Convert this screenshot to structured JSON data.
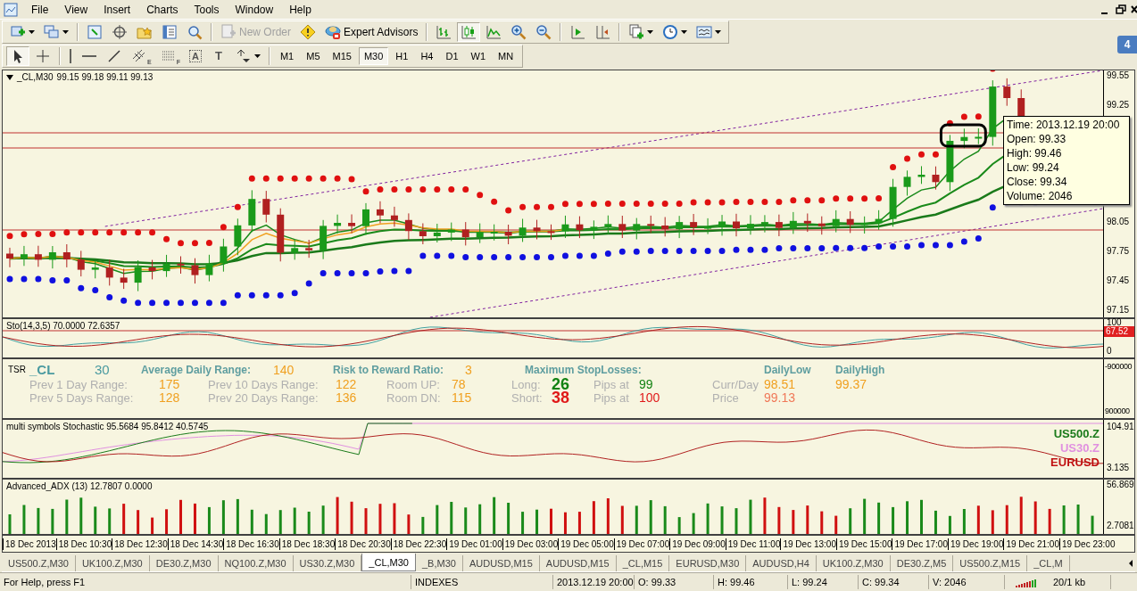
{
  "menu": [
    "File",
    "View",
    "Insert",
    "Charts",
    "Tools",
    "Window",
    "Help"
  ],
  "notification_count": "4",
  "toolbar_main": [
    {
      "kind": "menu-icon",
      "pressed": false
    },
    {
      "kind": "menu-icon",
      "pressed": false
    },
    {
      "kind": "separator"
    },
    {
      "kind": "icon",
      "pressed": false
    },
    {
      "kind": "icon",
      "pressed": false
    },
    {
      "kind": "icon",
      "pressed": false
    },
    {
      "kind": "icon",
      "pressed": false
    },
    {
      "kind": "icon",
      "pressed": false
    },
    {
      "kind": "separator"
    },
    {
      "kind": "labeled",
      "label": "New Order",
      "disabled": true
    },
    {
      "kind": "icon",
      "pressed": false
    },
    {
      "kind": "labeled",
      "label": "Expert Advisors",
      "disabled": false
    },
    {
      "kind": "separator"
    },
    {
      "kind": "icon",
      "pressed": false
    },
    {
      "kind": "icon",
      "pressed": true
    },
    {
      "kind": "icon",
      "pressed": false
    },
    {
      "kind": "icon",
      "pressed": false
    },
    {
      "kind": "icon",
      "pressed": false
    },
    {
      "kind": "separator"
    },
    {
      "kind": "icon",
      "pressed": false
    },
    {
      "kind": "icon",
      "pressed": false
    },
    {
      "kind": "separator"
    },
    {
      "kind": "menu-icon",
      "pressed": false
    },
    {
      "kind": "menu-icon",
      "pressed": false
    },
    {
      "kind": "menu-icon",
      "pressed": false
    }
  ],
  "toolbar_draw": [
    {
      "kind": "icon",
      "pressed": true
    },
    {
      "kind": "icon",
      "pressed": false
    },
    {
      "kind": "separator"
    },
    {
      "kind": "icon",
      "pressed": false
    },
    {
      "kind": "icon",
      "pressed": false
    },
    {
      "kind": "icon",
      "pressed": false
    },
    {
      "kind": "icon",
      "pressed": false,
      "label": "E"
    },
    {
      "kind": "icon",
      "pressed": false,
      "label": "F"
    },
    {
      "kind": "text-icon",
      "pressed": false,
      "label": "A"
    },
    {
      "kind": "text-icon",
      "pressed": false,
      "label": "T"
    },
    {
      "kind": "menu-icon",
      "pressed": false
    },
    {
      "kind": "separator"
    }
  ],
  "timeframes": [
    {
      "label": "M1",
      "selected": false
    },
    {
      "label": "M5",
      "selected": false
    },
    {
      "label": "M15",
      "selected": false
    },
    {
      "label": "M30",
      "selected": true
    },
    {
      "label": "H1",
      "selected": false
    },
    {
      "label": "H4",
      "selected": false
    },
    {
      "label": "D1",
      "selected": false
    },
    {
      "label": "W1",
      "selected": false
    },
    {
      "label": "MN",
      "selected": false
    }
  ],
  "main_chart": {
    "symbol": "_CL,M30",
    "ohlc": "99.15 99.18 99.11 99.13",
    "price_axis": [
      "99.55",
      "99.25",
      "98.05",
      "97.75",
      "97.45",
      "97.15"
    ],
    "tooltip": [
      "Time: 2013.12.19 20:00",
      "Open: 99.33",
      "High: 99.46",
      "Low:  99.24",
      "Close: 99.34",
      "Volume: 2046"
    ]
  },
  "stochastic": {
    "label": "Sto(14,3,5) 70.0000 72.6357",
    "axis": [
      "100",
      "0"
    ],
    "current": "67.52"
  },
  "tsr": {
    "label": "TSR",
    "header": [
      {
        "kind": "title",
        "text": "_CL"
      },
      {
        "kind": "title",
        "text": "30"
      },
      {
        "kind": "heading",
        "text": "Average Daily Range:"
      },
      {
        "kind": "value",
        "text": "140",
        "color": "#f0a020"
      },
      {
        "kind": "heading",
        "text": "Risk to Reward Ratio:"
      },
      {
        "kind": "value",
        "text": "3",
        "color": "#f0a020"
      },
      {
        "kind": "heading",
        "text": "Maximum StopLosses:"
      },
      {
        "kind": "heading",
        "text": "DailyLow"
      },
      {
        "kind": "heading",
        "text": "DailyHigh"
      }
    ],
    "rows": [
      [
        {
          "kind": "label",
          "text": "Prev 1 Day Range:"
        },
        {
          "kind": "value",
          "text": "175",
          "color": "#f0a020"
        },
        {
          "kind": "label",
          "text": "Prev 10 Days Range:"
        },
        {
          "kind": "value",
          "text": "122",
          "color": "#f0a020"
        },
        {
          "kind": "label",
          "text": "Room UP:"
        },
        {
          "kind": "value",
          "text": "78",
          "color": "#f0a020"
        },
        {
          "kind": "label",
          "text": "Long:"
        },
        {
          "kind": "big",
          "text": "26",
          "color": "#128212"
        },
        {
          "kind": "label",
          "text": "Pips at"
        },
        {
          "kind": "value",
          "text": "99",
          "color": "#128212"
        },
        {
          "kind": "label",
          "text": "Curr/Day"
        },
        {
          "kind": "value",
          "text": "98.51",
          "color": "#f0a020"
        },
        {
          "kind": "value",
          "text": "99.37",
          "color": "#f0a020"
        }
      ],
      [
        {
          "kind": "label",
          "text": "Prev 5 Days Range:"
        },
        {
          "kind": "value",
          "text": "128",
          "color": "#f0a020"
        },
        {
          "kind": "label",
          "text": "Prev 20 Days Range:"
        },
        {
          "kind": "value",
          "text": "136",
          "color": "#f0a020"
        },
        {
          "kind": "label",
          "text": "Room DN:"
        },
        {
          "kind": "value",
          "text": "115",
          "color": "#f0a020"
        },
        {
          "kind": "label",
          "text": "Short:"
        },
        {
          "kind": "big",
          "text": "38",
          "color": "#e01818"
        },
        {
          "kind": "label",
          "text": "Pips at"
        },
        {
          "kind": "value",
          "text": "100",
          "color": "#e01818"
        },
        {
          "kind": "label",
          "text": "Price"
        },
        {
          "kind": "value",
          "text": "99.13",
          "color": "#f07858"
        }
      ]
    ],
    "axis": [
      "-900000",
      "900000"
    ]
  },
  "multi_stochastic": {
    "label": "multi symbols Stochastic 95.5684 95.8412 40.5745",
    "axis": [
      "104.91",
      "3.135"
    ],
    "legend": [
      {
        "text": "US500.Z",
        "color": "#1a7a1a"
      },
      {
        "text": "US30.Z",
        "color": "#e090e0"
      },
      {
        "text": "EURUSD",
        "color": "#c01010"
      }
    ]
  },
  "adx": {
    "label": "Advanced_ADX (13) 12.7807 0.0000",
    "axis": [
      "56.869",
      "2.7081"
    ]
  },
  "time_axis": [
    "18 Dec 2013",
    "18 Dec 10:30",
    "18 Dec 12:30",
    "18 Dec 14:30",
    "18 Dec 16:30",
    "18 Dec 18:30",
    "18 Dec 20:30",
    "18 Dec 22:30",
    "19 Dec 01:00",
    "19 Dec 03:00",
    "19 Dec 05:00",
    "19 Dec 07:00",
    "19 Dec 09:00",
    "19 Dec 11:00",
    "19 Dec 13:00",
    "19 Dec 15:00",
    "19 Dec 17:00",
    "19 Dec 19:00",
    "19 Dec 21:00",
    "19 Dec 23:00"
  ],
  "tabs": [
    {
      "label": "US500.Z,M30",
      "selected": false
    },
    {
      "label": "UK100.Z,M30",
      "selected": false
    },
    {
      "label": "DE30.Z,M30",
      "selected": false
    },
    {
      "label": "NQ100.Z,M30",
      "selected": false
    },
    {
      "label": "US30.Z,M30",
      "selected": false
    },
    {
      "label": "_CL,M30",
      "selected": true
    },
    {
      "label": "_B,M30",
      "selected": false
    },
    {
      "label": "AUDUSD,M15",
      "selected": false
    },
    {
      "label": "AUDUSD,M15",
      "selected": false
    },
    {
      "label": "_CL,M15",
      "selected": false
    },
    {
      "label": "EURUSD,M30",
      "selected": false
    },
    {
      "label": "AUDUSD,H4",
      "selected": false
    },
    {
      "label": "UK100.Z,M30",
      "selected": false
    },
    {
      "label": "DE30.Z,M5",
      "selected": false
    },
    {
      "label": "US500.Z,M15",
      "selected": false
    },
    {
      "label": "_CL,M",
      "selected": false
    }
  ],
  "status_bar": {
    "help": "For Help, press F1",
    "profile": "INDEXES",
    "time": "2013.12.19 20:00",
    "open": "O: 99.33",
    "high": "H: 99.46",
    "low": "L: 99.24",
    "close": "C: 99.34",
    "volume": "V: 2046",
    "traffic": "20/1 kb"
  }
}
